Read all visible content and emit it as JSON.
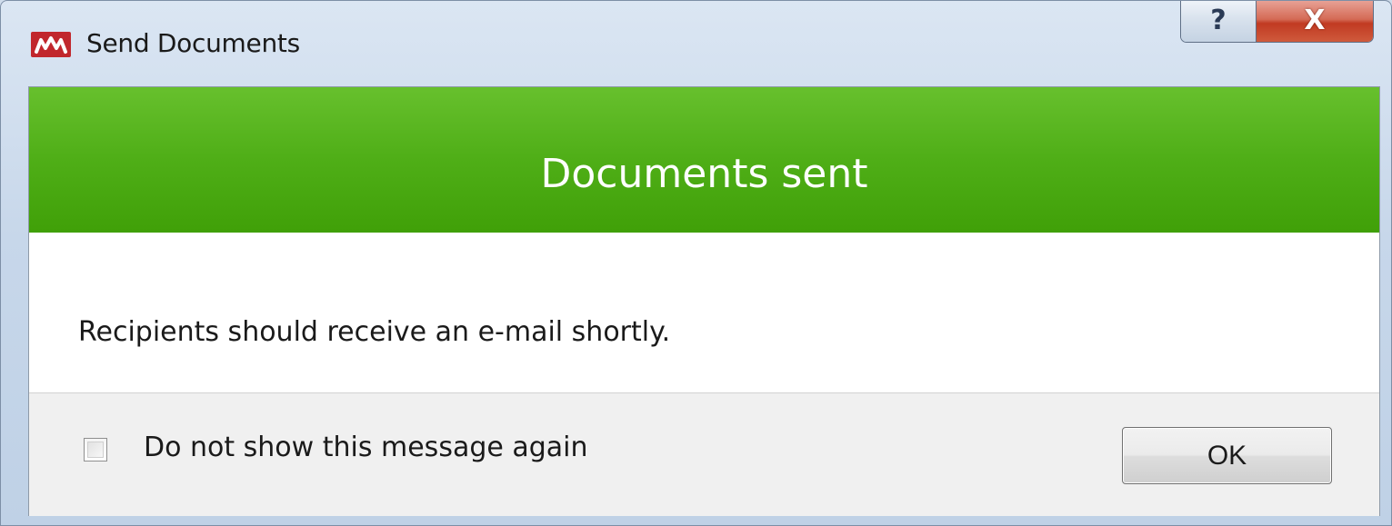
{
  "window": {
    "title": "Send Documents",
    "app_icon": "mimecast-logo-icon",
    "help_glyph": "?",
    "close_glyph": "X"
  },
  "banner": {
    "text": "Documents sent",
    "color": "#4fae17"
  },
  "message": {
    "text": "Recipients should receive an e-mail shortly."
  },
  "footer": {
    "checkbox_label": "Do not show this message again",
    "checkbox_checked": false,
    "ok_label": "OK"
  }
}
